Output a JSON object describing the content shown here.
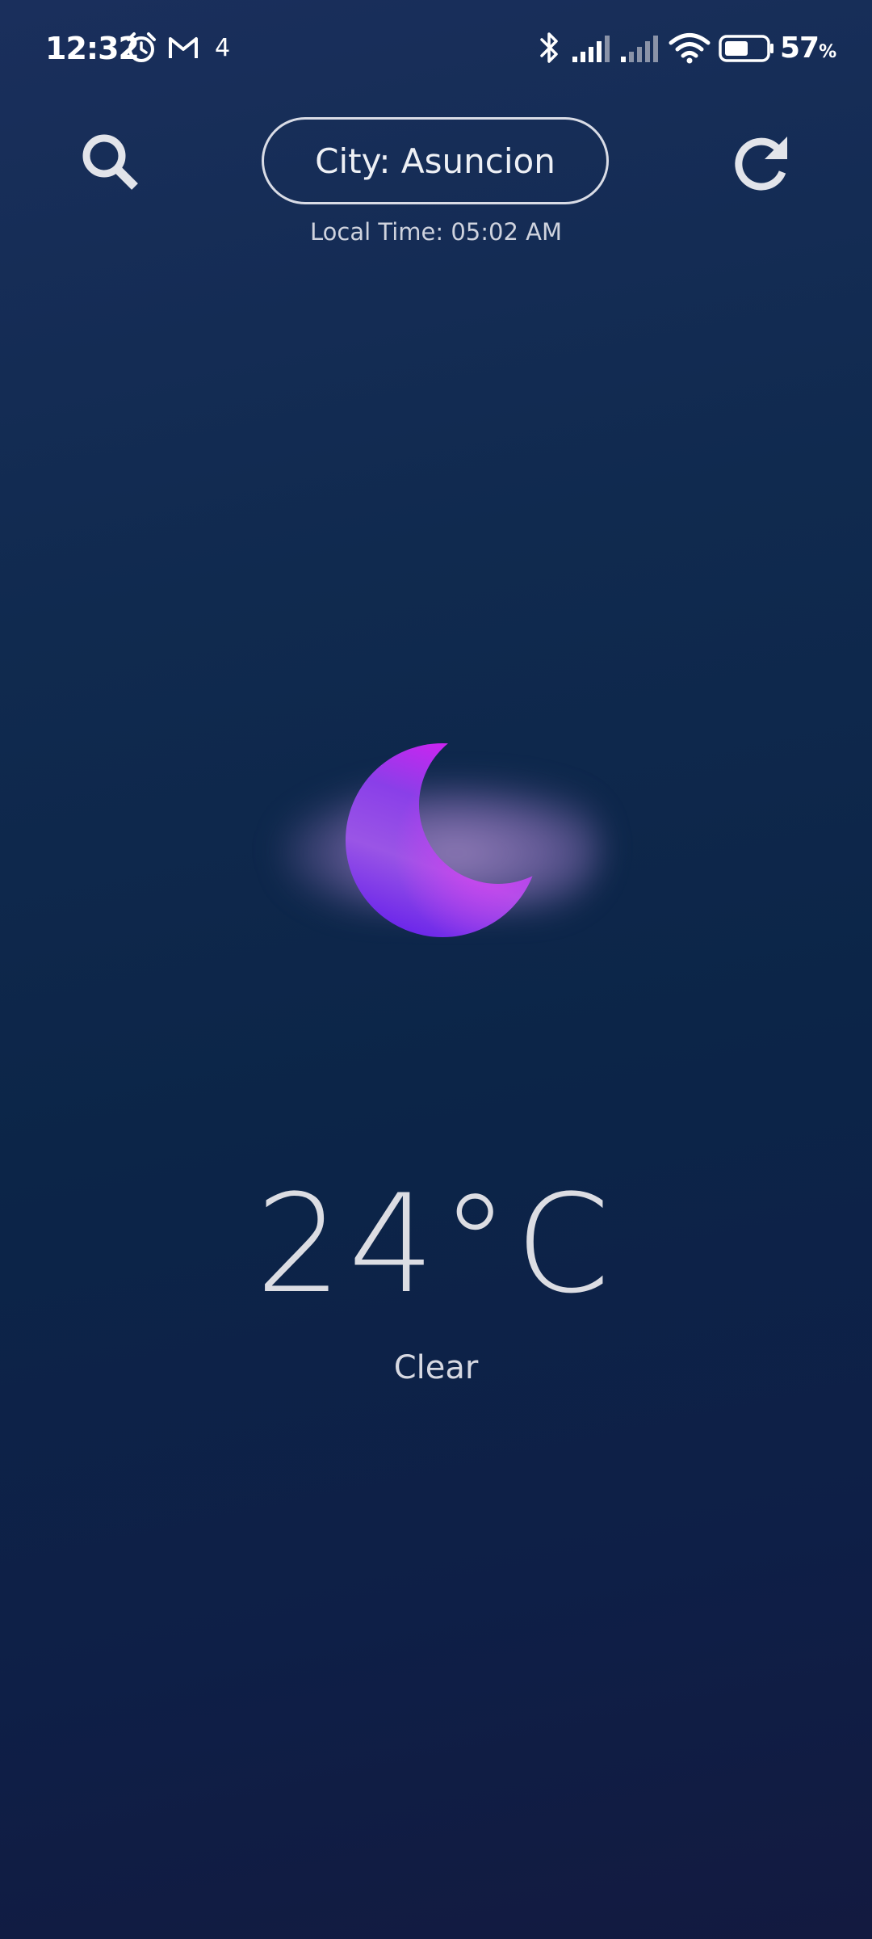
{
  "status_bar": {
    "time": "12:32",
    "notification_count": "4",
    "battery_percent": "57",
    "battery_unit": "%",
    "icons": [
      "alarm-icon",
      "gmail-icon",
      "bluetooth-icon",
      "signal-sim1-icon",
      "signal-sim2-icon",
      "wifi-icon",
      "battery-icon"
    ],
    "battery_level": 0.57
  },
  "header": {
    "city_label": "City: Asuncion",
    "local_time": "Local Time: 05:02 AM",
    "search_icon": "search-icon",
    "refresh_icon": "refresh-icon"
  },
  "weather": {
    "icon": "moon-cloud-icon",
    "temperature": "24°C",
    "condition": "Clear"
  },
  "colors": {
    "background_top": "#1a2f5c",
    "background_bottom": "#131a40",
    "moon_light": "#d21cf0",
    "moon_dark": "#6a2ce6",
    "text": "#e8e8ee"
  }
}
